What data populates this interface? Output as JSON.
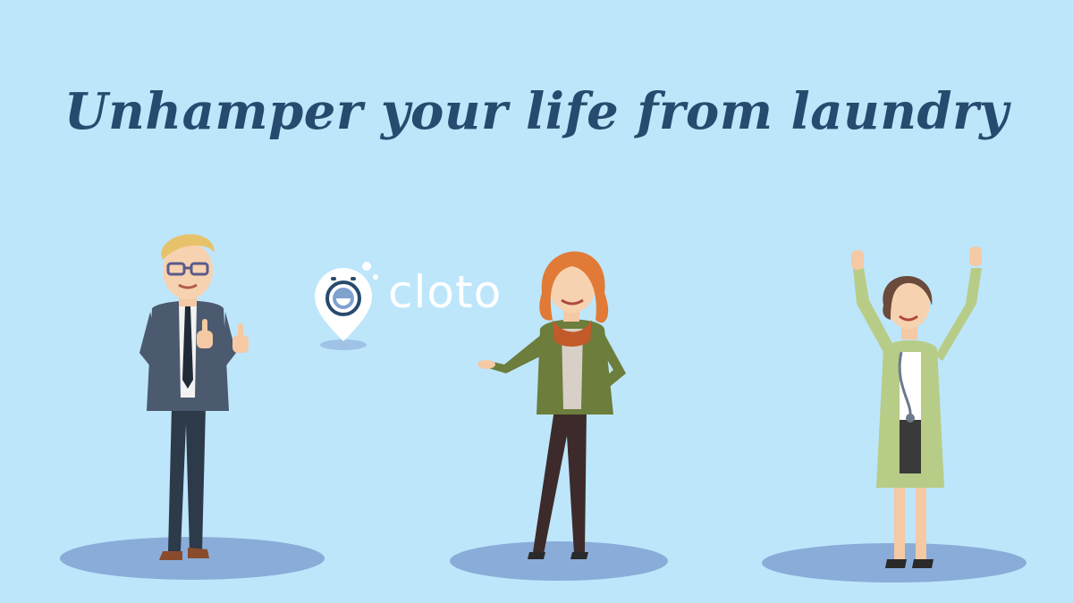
{
  "headline": "Unhamper your life from laundry",
  "logo": {
    "wordmark": "cloto",
    "icon": "washing-machine-pin-icon"
  },
  "colors": {
    "background": "#bde6fb",
    "headline": "#274b6e",
    "shadow": "#8aacd8",
    "logo_accent": "#274b6e"
  },
  "characters": [
    {
      "role": "businessman",
      "pose": "thumbs-up"
    },
    {
      "role": "woman-in-green-jacket",
      "pose": "presenting"
    },
    {
      "role": "doctor",
      "pose": "arms-raised"
    }
  ]
}
